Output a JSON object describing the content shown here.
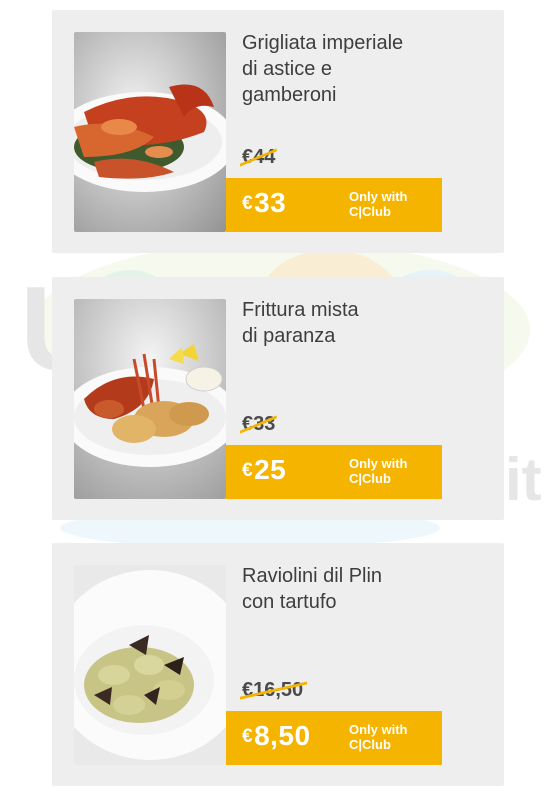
{
  "colors": {
    "card_bg": "#eeeeee",
    "promo_bg": "#f5b400",
    "promo_text": "#ffffff",
    "title_text": "#3e3e3e"
  },
  "offers": [
    {
      "title_line1": "Grigliata imperiale",
      "title_line2": "di astice e",
      "title_line3": "gamberoni",
      "old_price": "€44",
      "currency": "€",
      "new_price": "33",
      "note_line1": "Only with",
      "note_line2": "C|Club",
      "image": "lobster-platter-image"
    },
    {
      "title_line1": "Frittura mista",
      "title_line2": "di paranza",
      "title_line3": "",
      "old_price": "€33",
      "currency": "€",
      "new_price": "25",
      "note_line1": "Only with",
      "note_line2": "C|Club",
      "image": "fried-fish-platter-image"
    },
    {
      "title_line1": "Raviolini dil Plin",
      "title_line2": "con tartufo",
      "title_line3": "",
      "old_price": "€16,50",
      "currency": "€",
      "new_price": "8,50",
      "note_line1": "Only with",
      "note_line2": "C|Club",
      "image": "truffle-ravioli-image"
    }
  ]
}
